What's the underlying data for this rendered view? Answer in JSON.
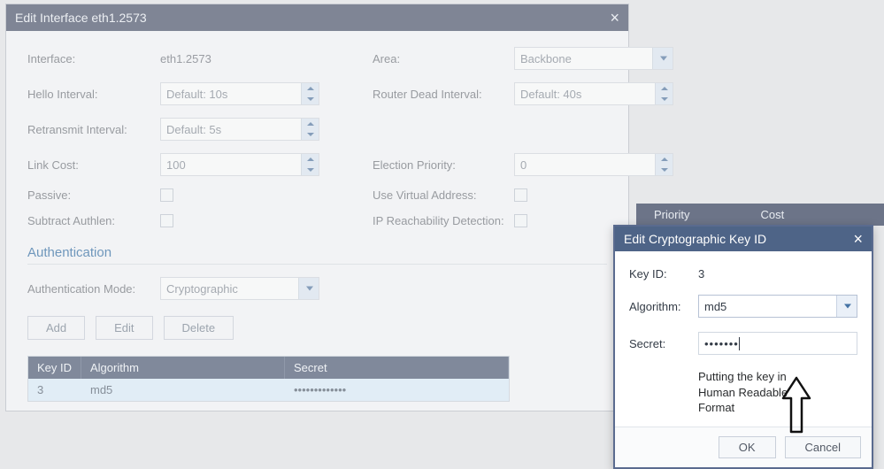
{
  "main_dialog": {
    "title": "Edit Interface eth1.2573",
    "fields": {
      "interface_label": "Interface:",
      "interface_value": "eth1.2573",
      "area_label": "Area:",
      "area_value": "Backbone",
      "hello_label": "Hello Interval:",
      "hello_placeholder": "Default: 10s",
      "rdi_label": "Router Dead Interval:",
      "rdi_placeholder": "Default: 40s",
      "retransmit_label": "Retransmit Interval:",
      "retransmit_placeholder": "Default: 5s",
      "linkcost_label": "Link Cost:",
      "linkcost_value": "100",
      "election_label": "Election Priority:",
      "election_value": "0",
      "passive_label": "Passive:",
      "vaddr_label": "Use Virtual Address:",
      "subtract_label": "Subtract Authlen:",
      "ipreach_label": "IP Reachability Detection:"
    },
    "auth": {
      "section_title": "Authentication",
      "mode_label": "Authentication Mode:",
      "mode_value": "Cryptographic",
      "add_btn": "Add",
      "edit_btn": "Edit",
      "delete_btn": "Delete",
      "headers": {
        "keyid": "Key ID",
        "algo": "Algorithm",
        "secret": "Secret"
      },
      "rows": [
        {
          "keyid": "3",
          "algo": "md5",
          "secret": "•••••••••••••"
        }
      ]
    }
  },
  "bg_headers": {
    "col1": "Priority",
    "col2": "Cost"
  },
  "front_dialog": {
    "title": "Edit Cryptographic Key ID",
    "keyid_label": "Key ID:",
    "keyid_value": "3",
    "algo_label": "Algorithm:",
    "algo_value": "md5",
    "secret_label": "Secret:",
    "secret_value": "•••••••",
    "note_line1": "Putting the key in",
    "note_line2": "Human Readable",
    "note_line3": "Format",
    "ok": "OK",
    "cancel": "Cancel"
  }
}
